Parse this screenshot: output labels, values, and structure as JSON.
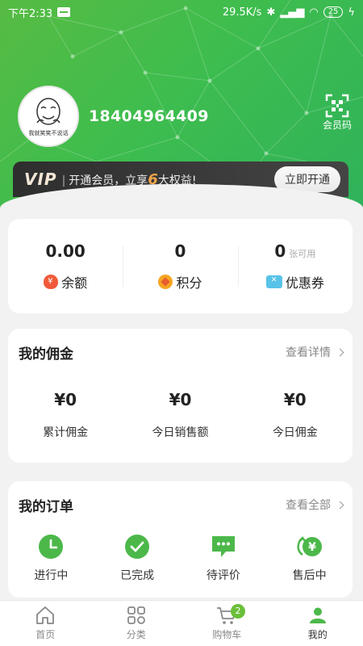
{
  "status_bar": {
    "time": "下午2:33",
    "network_speed": "29.5K/s",
    "battery": "25"
  },
  "profile": {
    "avatar_caption": "我就笑笑不说话",
    "phone": "18404964409",
    "member_code_label": "会员码"
  },
  "vip": {
    "logo": "VIP",
    "text_prefix": "开通会员，立享",
    "count": "6",
    "text_suffix": "大权益!",
    "button": "立即开通"
  },
  "stats": [
    {
      "value": "0.00",
      "suffix": "",
      "label": "余额",
      "icon": "money-bag-icon"
    },
    {
      "value": "0",
      "suffix": "",
      "label": "积分",
      "icon": "points-coin-icon"
    },
    {
      "value": "0",
      "suffix": "张可用",
      "label": "优惠券",
      "icon": "coupon-icon"
    }
  ],
  "commission": {
    "title": "我的佣金",
    "link": "查看详情",
    "items": [
      {
        "value": "¥0",
        "label": "累计佣金"
      },
      {
        "value": "¥0",
        "label": "今日销售额"
      },
      {
        "value": "¥0",
        "label": "今日佣金"
      }
    ]
  },
  "orders": {
    "title": "我的订单",
    "link": "查看全部",
    "items": [
      {
        "label": "进行中",
        "icon": "clock-icon"
      },
      {
        "label": "已完成",
        "icon": "check-circle-icon"
      },
      {
        "label": "待评价",
        "icon": "chat-bubble-icon"
      },
      {
        "label": "售后中",
        "icon": "refund-icon"
      }
    ]
  },
  "tabbar": {
    "items": [
      {
        "label": "首页",
        "icon": "home-icon"
      },
      {
        "label": "分类",
        "icon": "grid-icon"
      },
      {
        "label": "购物车",
        "icon": "cart-icon",
        "badge": "2"
      },
      {
        "label": "我的",
        "icon": "profile-icon"
      }
    ],
    "active": "我的"
  },
  "colors": {
    "brand_green": "#4cbb47",
    "vip_dark": "#333333",
    "vip_accent": "#f0a34a"
  }
}
